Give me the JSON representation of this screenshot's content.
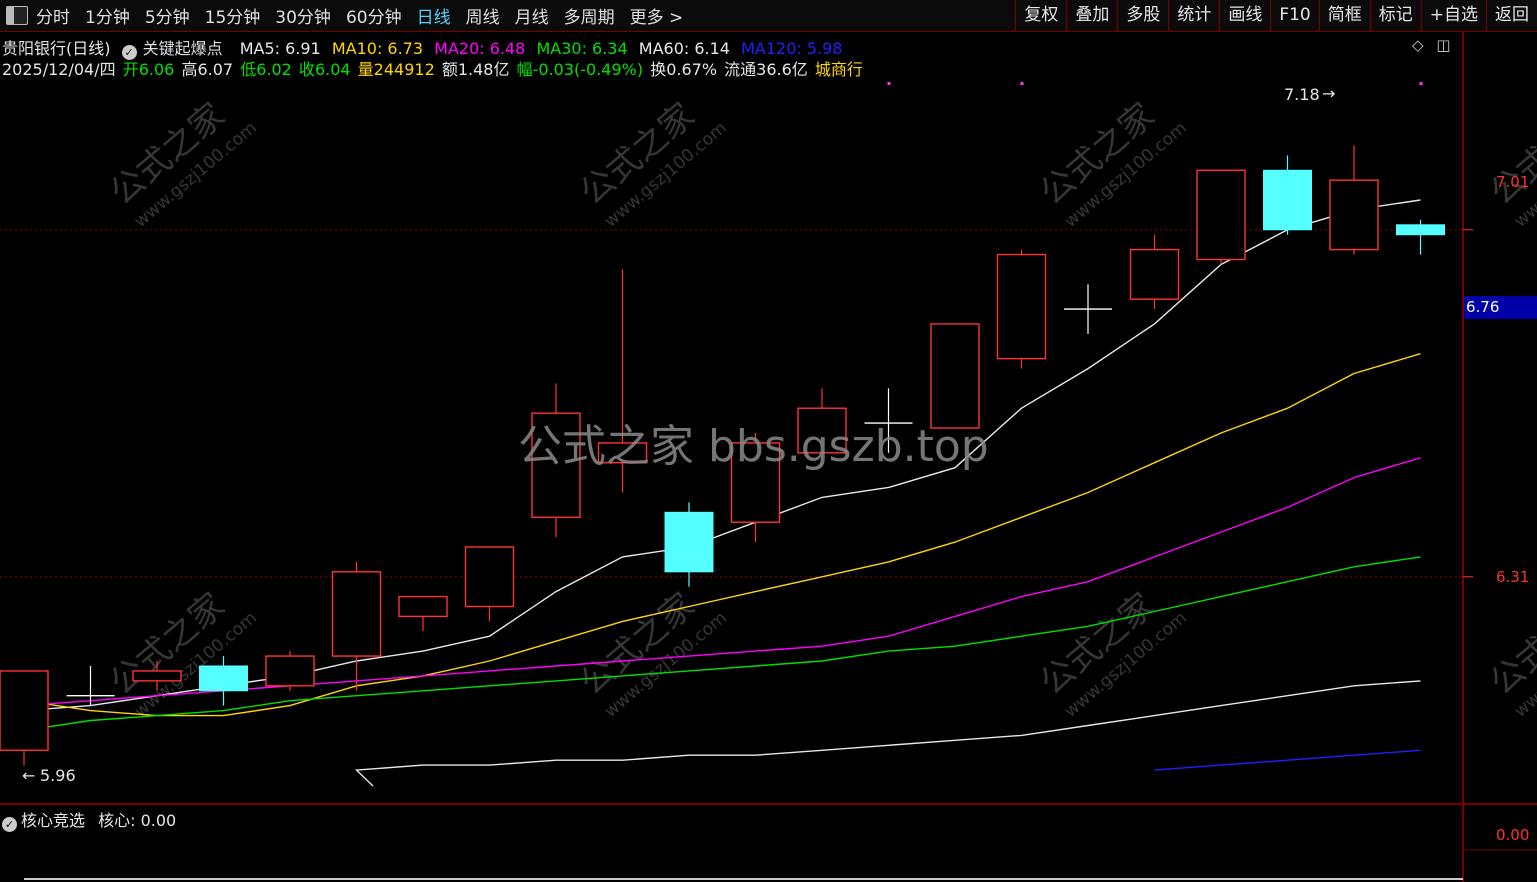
{
  "toolbar": {
    "periods": [
      "分时",
      "1分钟",
      "5分钟",
      "15分钟",
      "30分钟",
      "60分钟",
      "日线",
      "周线",
      "月线",
      "多周期",
      "更多 >"
    ],
    "active_period": "日线",
    "right_buttons": [
      "复权",
      "叠加",
      "多股",
      "统计",
      "画线",
      "F10",
      "简框",
      "标记",
      "+自选",
      "返回"
    ]
  },
  "header": {
    "stock": "贵阳银行(日线)",
    "indicator": "关键起爆点",
    "ma": [
      {
        "label": "MA5: 6.91",
        "color": "#e8e8e8"
      },
      {
        "label": "MA10: 6.73",
        "color": "#ffd700"
      },
      {
        "label": "MA20: 6.48",
        "color": "#ff00ff"
      },
      {
        "label": "MA30: 6.34",
        "color": "#00e000"
      },
      {
        "label": "MA60: 6.14",
        "color": "#e8e8e8"
      },
      {
        "label": "MA120: 5.98",
        "color": "#2020ff"
      }
    ],
    "date": "2025/12/04/四",
    "open_label": "开",
    "open": "6.06",
    "high_label": "高",
    "high": "6.07",
    "low_label": "低",
    "low": "6.02",
    "close_label": "收",
    "close": "6.04",
    "vol_label": "量",
    "vol": "244912",
    "amount_label": "额",
    "amount": "1.48亿",
    "change_label": "幅",
    "change": "-0.03(-0.49%)",
    "turnover_label": "换",
    "turnover": "0.67%",
    "float_label": "流通",
    "float": "36.6亿",
    "sector": "城商行"
  },
  "top_icons": [
    "◇",
    "◫"
  ],
  "price_axis": {
    "upper": "7.01",
    "current": "6.76",
    "lower": "6.31",
    "sub": "0.00"
  },
  "annotations": {
    "high_mark": "7.18",
    "low_mark": "5.96",
    "high_arrow": "→",
    "low_arrow": "←"
  },
  "sub_panel": {
    "title": "核心竞选",
    "value_label": "核心: 0.00"
  },
  "watermark": {
    "center": "公式之家 bbs.gszb.top",
    "diag_cn": "公式之家",
    "diag_url": "www.gszj100.com"
  },
  "colors": {
    "up": "#ff3333",
    "down": "#55ffff",
    "grid": "#8b0000",
    "frame": "#7a0000"
  },
  "chart_data": {
    "type": "candlestick",
    "y_range": [
      5.9,
      7.3
    ],
    "candles": [
      {
        "o": 5.96,
        "c": 6.12,
        "h": 6.12,
        "l": 5.93
      },
      {
        "o": 6.07,
        "c": 6.07,
        "h": 6.13,
        "l": 6.05
      },
      {
        "o": 6.1,
        "c": 6.12,
        "h": 6.14,
        "l": 6.08
      },
      {
        "o": 6.13,
        "c": 6.08,
        "h": 6.15,
        "l": 6.05
      },
      {
        "o": 6.09,
        "c": 6.15,
        "h": 6.16,
        "l": 6.08
      },
      {
        "o": 6.15,
        "c": 6.32,
        "h": 6.34,
        "l": 6.08
      },
      {
        "o": 6.23,
        "c": 6.27,
        "h": 6.27,
        "l": 6.2
      },
      {
        "o": 6.25,
        "c": 6.37,
        "h": 6.37,
        "l": 6.22
      },
      {
        "o": 6.43,
        "c": 6.64,
        "h": 6.7,
        "l": 6.39
      },
      {
        "o": 6.54,
        "c": 6.58,
        "h": 6.93,
        "l": 6.48
      },
      {
        "o": 6.44,
        "c": 6.32,
        "h": 6.46,
        "l": 6.29
      },
      {
        "o": 6.42,
        "c": 6.58,
        "h": 6.6,
        "l": 6.38
      },
      {
        "o": 6.56,
        "c": 6.65,
        "h": 6.69,
        "l": 6.56
      },
      {
        "o": 6.62,
        "c": 6.62,
        "h": 6.69,
        "l": 6.56
      },
      {
        "o": 6.61,
        "c": 6.82,
        "h": 6.82,
        "l": 6.61
      },
      {
        "o": 6.75,
        "c": 6.96,
        "h": 6.97,
        "l": 6.73
      },
      {
        "o": 6.85,
        "c": 6.85,
        "h": 6.9,
        "l": 6.8
      },
      {
        "o": 6.87,
        "c": 6.97,
        "h": 7.0,
        "l": 6.85
      },
      {
        "o": 6.95,
        "c": 7.13,
        "h": 7.13,
        "l": 6.94
      },
      {
        "o": 7.13,
        "c": 7.01,
        "h": 7.16,
        "l": 7.0
      },
      {
        "o": 6.97,
        "c": 7.11,
        "h": 7.18,
        "l": 6.96
      },
      {
        "o": 7.02,
        "c": 7.0,
        "h": 7.03,
        "l": 6.96
      }
    ],
    "ma_series": [
      {
        "name": "MA5",
        "color": "#e8e8e8",
        "values": [
          6.04,
          6.05,
          6.07,
          6.09,
          6.11,
          6.14,
          6.16,
          6.19,
          6.28,
          6.35,
          6.37,
          6.42,
          6.47,
          6.49,
          6.53,
          6.65,
          6.73,
          6.82,
          6.94,
          7.01,
          7.05,
          7.07
        ]
      },
      {
        "name": "MA10",
        "color": "#ffd700",
        "values": [
          6.06,
          6.04,
          6.03,
          6.03,
          6.05,
          6.09,
          6.11,
          6.14,
          6.18,
          6.22,
          6.25,
          6.28,
          6.31,
          6.34,
          6.38,
          6.43,
          6.48,
          6.54,
          6.6,
          6.65,
          6.72,
          6.76
        ]
      },
      {
        "name": "MA20",
        "color": "#ff00ff",
        "values": [
          6.05,
          6.06,
          6.07,
          6.08,
          6.09,
          6.1,
          6.11,
          6.12,
          6.13,
          6.14,
          6.15,
          6.16,
          6.17,
          6.19,
          6.23,
          6.27,
          6.3,
          6.35,
          6.4,
          6.45,
          6.51,
          6.55
        ]
      },
      {
        "name": "MA30",
        "color": "#00e000",
        "values": [
          6.0,
          6.02,
          6.03,
          6.04,
          6.06,
          6.07,
          6.08,
          6.09,
          6.1,
          6.11,
          6.12,
          6.13,
          6.14,
          6.16,
          6.17,
          6.19,
          6.21,
          6.24,
          6.27,
          6.3,
          6.33,
          6.35
        ]
      },
      {
        "name": "MA60",
        "color": "#e8e8e8",
        "values": [
          null,
          null,
          null,
          null,
          null,
          5.92,
          5.93,
          5.93,
          5.94,
          5.94,
          5.95,
          5.95,
          5.96,
          5.97,
          5.98,
          5.99,
          6.01,
          6.03,
          6.05,
          6.07,
          6.09,
          6.1
        ]
      },
      {
        "name": "MA120",
        "color": "#2020ff",
        "values": [
          null,
          null,
          null,
          null,
          null,
          null,
          null,
          null,
          null,
          null,
          null,
          null,
          null,
          null,
          null,
          null,
          null,
          5.92,
          5.93,
          5.94,
          5.95,
          5.96
        ]
      }
    ]
  }
}
